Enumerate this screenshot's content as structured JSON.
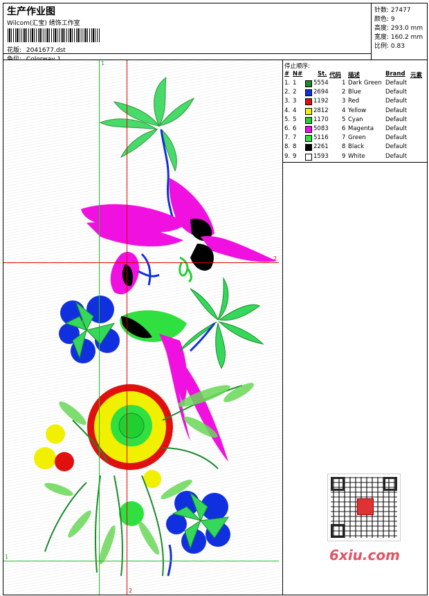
{
  "header": {
    "title": "生产作业图",
    "company": "Wilcom(汇宝) 绣饰工作室",
    "design_label": "花版:",
    "design_value": "2041677.dst",
    "colorway_label": "色位:",
    "colorway_value": "Colorway 1"
  },
  "stats": [
    {
      "label": "针数:",
      "value": "27477"
    },
    {
      "label": "颜色:",
      "value": "9"
    },
    {
      "label": "高度:",
      "value": "293.0 mm"
    },
    {
      "label": "宽度:",
      "value": "160.2 mm"
    },
    {
      "label": "比例:",
      "value": "0.83"
    }
  ],
  "stop_sequence": {
    "title": "停止顺序:",
    "headers": {
      "num": "#",
      "no": "N#",
      "st": "St.",
      "code": "代码",
      "desc": "描述",
      "brand": "Brand",
      "elem": "元素"
    },
    "rows": [
      {
        "num": "1.",
        "no": "1",
        "st": "5554",
        "code": "1",
        "desc": "Dark Green",
        "brand": "Default",
        "color": "#1a8a2a"
      },
      {
        "num": "2.",
        "no": "2",
        "st": "2694",
        "code": "2",
        "desc": "Blue",
        "brand": "Default",
        "color": "#1030e0"
      },
      {
        "num": "3.",
        "no": "3",
        "st": "1192",
        "code": "3",
        "desc": "Red",
        "brand": "Default",
        "color": "#e01010"
      },
      {
        "num": "4.",
        "no": "4",
        "st": "2812",
        "code": "4",
        "desc": "Yellow",
        "brand": "Default",
        "color": "#f0f000"
      },
      {
        "num": "5.",
        "no": "5",
        "st": "1170",
        "code": "5",
        "desc": "Cyan",
        "brand": "Default",
        "color": "#20d030"
      },
      {
        "num": "6.",
        "no": "6",
        "st": "5083",
        "code": "6",
        "desc": "Magenta",
        "brand": "Default",
        "color": "#f010e0"
      },
      {
        "num": "7.",
        "no": "7",
        "st": "5116",
        "code": "7",
        "desc": "Green",
        "brand": "Default",
        "color": "#30e040"
      },
      {
        "num": "8.",
        "no": "8",
        "st": "2261",
        "code": "8",
        "desc": "Black",
        "brand": "Default",
        "color": "#000000"
      },
      {
        "num": "9.",
        "no": "9",
        "st": "1593",
        "code": "9",
        "desc": "White",
        "brand": "Default",
        "color": "#ffffff"
      }
    ]
  },
  "guides": {
    "h1": "1",
    "h2": "2",
    "v1": "1",
    "v2": "2"
  },
  "watermark": "6xiu.com"
}
